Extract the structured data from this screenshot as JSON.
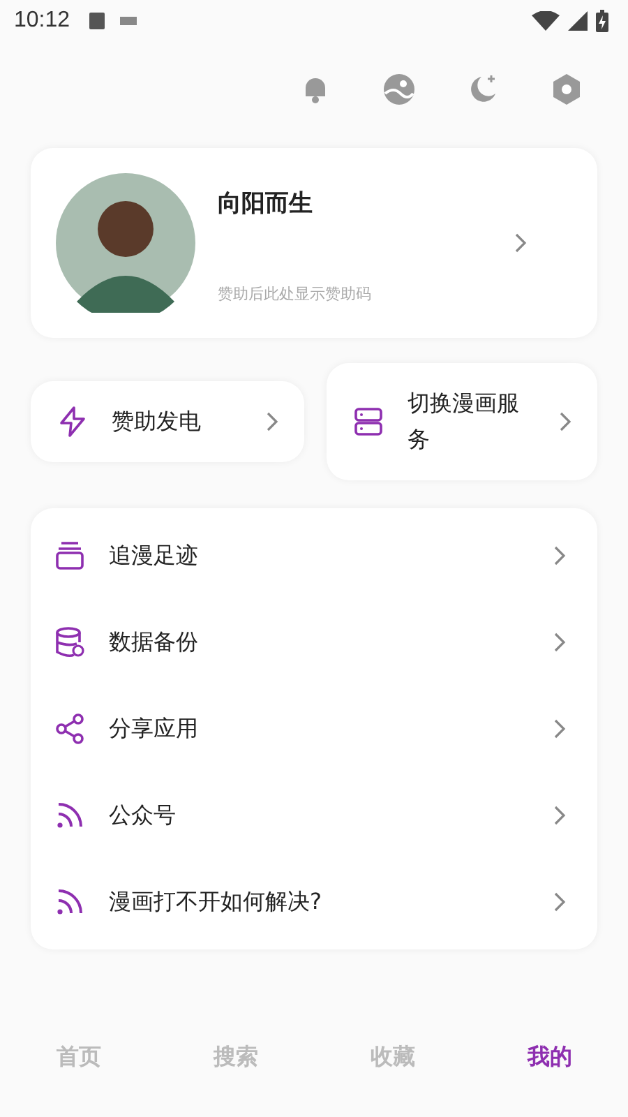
{
  "status_bar": {
    "time": "10:12"
  },
  "profile": {
    "name": "向阳而生",
    "subtitle": "赞助后此处显示赞助码"
  },
  "quick_actions": [
    {
      "kind": "bolt",
      "label": "赞助发电"
    },
    {
      "kind": "server",
      "label": "切换漫画服务"
    }
  ],
  "menu": [
    {
      "kind": "stack",
      "label": "追漫足迹"
    },
    {
      "kind": "database",
      "label": "数据备份"
    },
    {
      "kind": "share",
      "label": "分享应用"
    },
    {
      "kind": "rss",
      "label": "公众号"
    },
    {
      "kind": "rss",
      "label": "漫画打不开如何解决?"
    }
  ],
  "bottom_nav": [
    {
      "label": "首页",
      "selected": false
    },
    {
      "label": "搜索",
      "selected": false
    },
    {
      "label": "收藏",
      "selected": false
    },
    {
      "label": "我的",
      "selected": true
    }
  ]
}
